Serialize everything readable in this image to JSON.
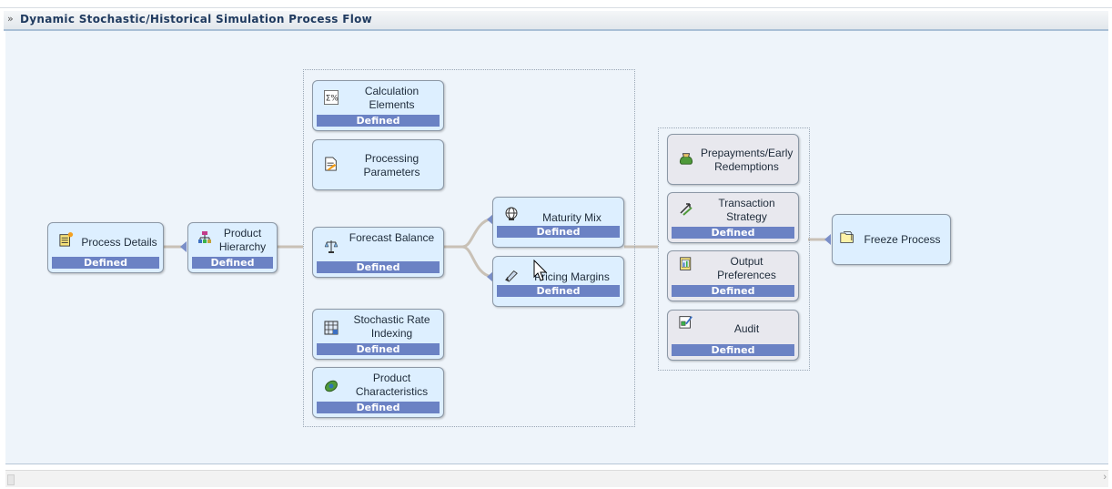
{
  "panel": {
    "collapse_icon": "»",
    "title": "Dynamic Stochastic/Historical Simulation Process Flow"
  },
  "colors": {
    "node_fill": "#ddefff",
    "node_fill_grey": "#e8e8ee",
    "status_bar": "#6b82c4",
    "connector": "#c9c1b6",
    "canvas": "#eef4fa"
  },
  "nodes": {
    "process_details": {
      "label": "Process Details",
      "status": "Defined",
      "icon": "notepad-star-icon"
    },
    "product_hierarchy": {
      "label": "Product Hierarchy",
      "status": "Defined",
      "icon": "hierarchy-icon"
    },
    "calculation_elements": {
      "label": "Calculation Elements",
      "status": "Defined",
      "icon": "sigma-percent-icon"
    },
    "processing_parameters": {
      "label": "Processing Parameters",
      "icon": "document-pencil-icon"
    },
    "forecast_balance": {
      "label": "Forecast Balance",
      "status": "Defined",
      "icon": "scales-icon"
    },
    "stochastic_rate_indexing": {
      "label": "Stochastic Rate Indexing",
      "status": "Defined",
      "icon": "calculator-grid-icon"
    },
    "product_characteristics": {
      "label": "Product Characteristics",
      "status": "Defined",
      "icon": "leaf-icon"
    },
    "maturity_mix": {
      "label": "Maturity Mix",
      "status": "Defined",
      "icon": "globe-icon"
    },
    "pricing_margins": {
      "label": "Pricing Margins",
      "status": "Defined",
      "icon": "pen-icon"
    },
    "prepayments": {
      "label": "Prepayments/Early Redemptions",
      "icon": "money-bag-icon"
    },
    "transaction_strategy": {
      "label": "Transaction Strategy",
      "status": "Defined",
      "icon": "arrows-icon"
    },
    "output_preferences": {
      "label": "Output Preferences",
      "status": "Defined",
      "icon": "report-icon"
    },
    "audit": {
      "label": "Audit",
      "status": "Defined",
      "icon": "clipboard-check-icon"
    },
    "freeze_process": {
      "label": "Freeze Process",
      "icon": "folder-icon"
    }
  }
}
